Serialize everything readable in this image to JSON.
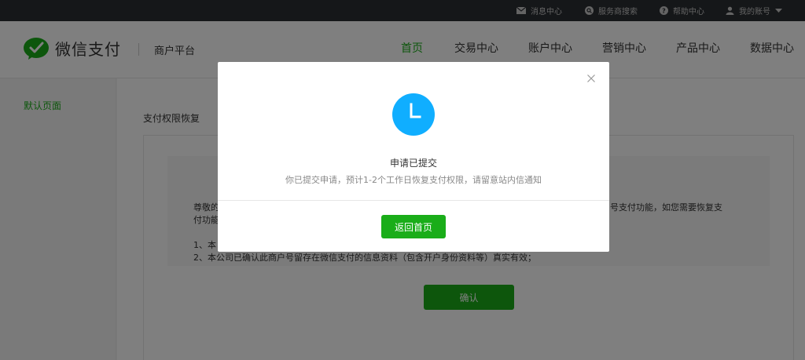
{
  "topbar": {
    "messages": "消息中心",
    "service_search": "服务商搜索",
    "help": "帮助中心",
    "account": "我的账号"
  },
  "header": {
    "brand": "微信支付",
    "platform": "商户平台",
    "nav": [
      "首页",
      "交易中心",
      "账户中心",
      "营销中心",
      "产品中心",
      "数据中心"
    ]
  },
  "sidebar": {
    "items": [
      "默认页面"
    ]
  },
  "main": {
    "page_title": "支付权限恢复",
    "notice_line1_start": "尊敬的",
    "notice_line1_end": "户号支付功能，如您需要恢复支",
    "notice_line2": "付功能",
    "notice_item1": "1、本",
    "notice_item2": "2、本公司已确认此商户号留存在微信支付的信息资料（包含开户身份资料等）真实有效；",
    "confirm_label": "确认"
  },
  "modal": {
    "title": "申请已提交",
    "description": "你已提交申请，预计1-2个工作日恢复支付权限，请留意站内信通知",
    "button_label": "返回首页"
  },
  "colors": {
    "accent": "#1aad19",
    "clock": "#10aeff",
    "topbar": "#2b2e33"
  }
}
